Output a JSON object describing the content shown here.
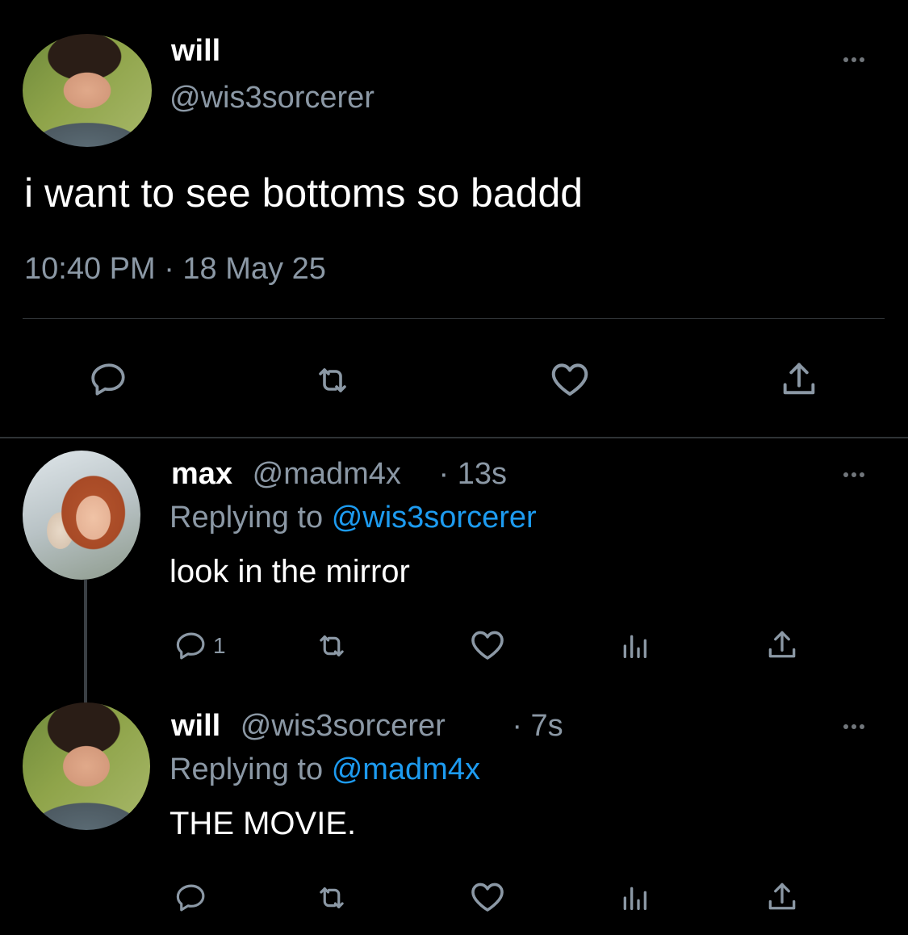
{
  "main_tweet": {
    "name": "will",
    "handle": "@wis3sorcerer",
    "text": "i want to see bottoms so baddd",
    "timestamp": "10:40 PM · 18 May 25",
    "actions": [
      "reply-icon",
      "retweet-icon",
      "like-icon",
      "share-icon"
    ]
  },
  "replies": [
    {
      "name": "max",
      "handle": "@madm4x",
      "time": "· 13s",
      "replying_prefix": "Replying to",
      "replying_to": "@wis3sorcerer",
      "text": "look in the mirror",
      "reply_count": "1"
    },
    {
      "name": "will",
      "handle": "@wis3sorcerer",
      "time": "· 7s",
      "replying_prefix": "Replying to",
      "replying_to": "@madm4x",
      "text": "THE MOVIE.",
      "reply_count": ""
    }
  ],
  "colors": {
    "background": "#000000",
    "text": "#e7e9ea",
    "muted": "#8b98a5",
    "link": "#1d9bf0",
    "divider": "#2f3336"
  }
}
